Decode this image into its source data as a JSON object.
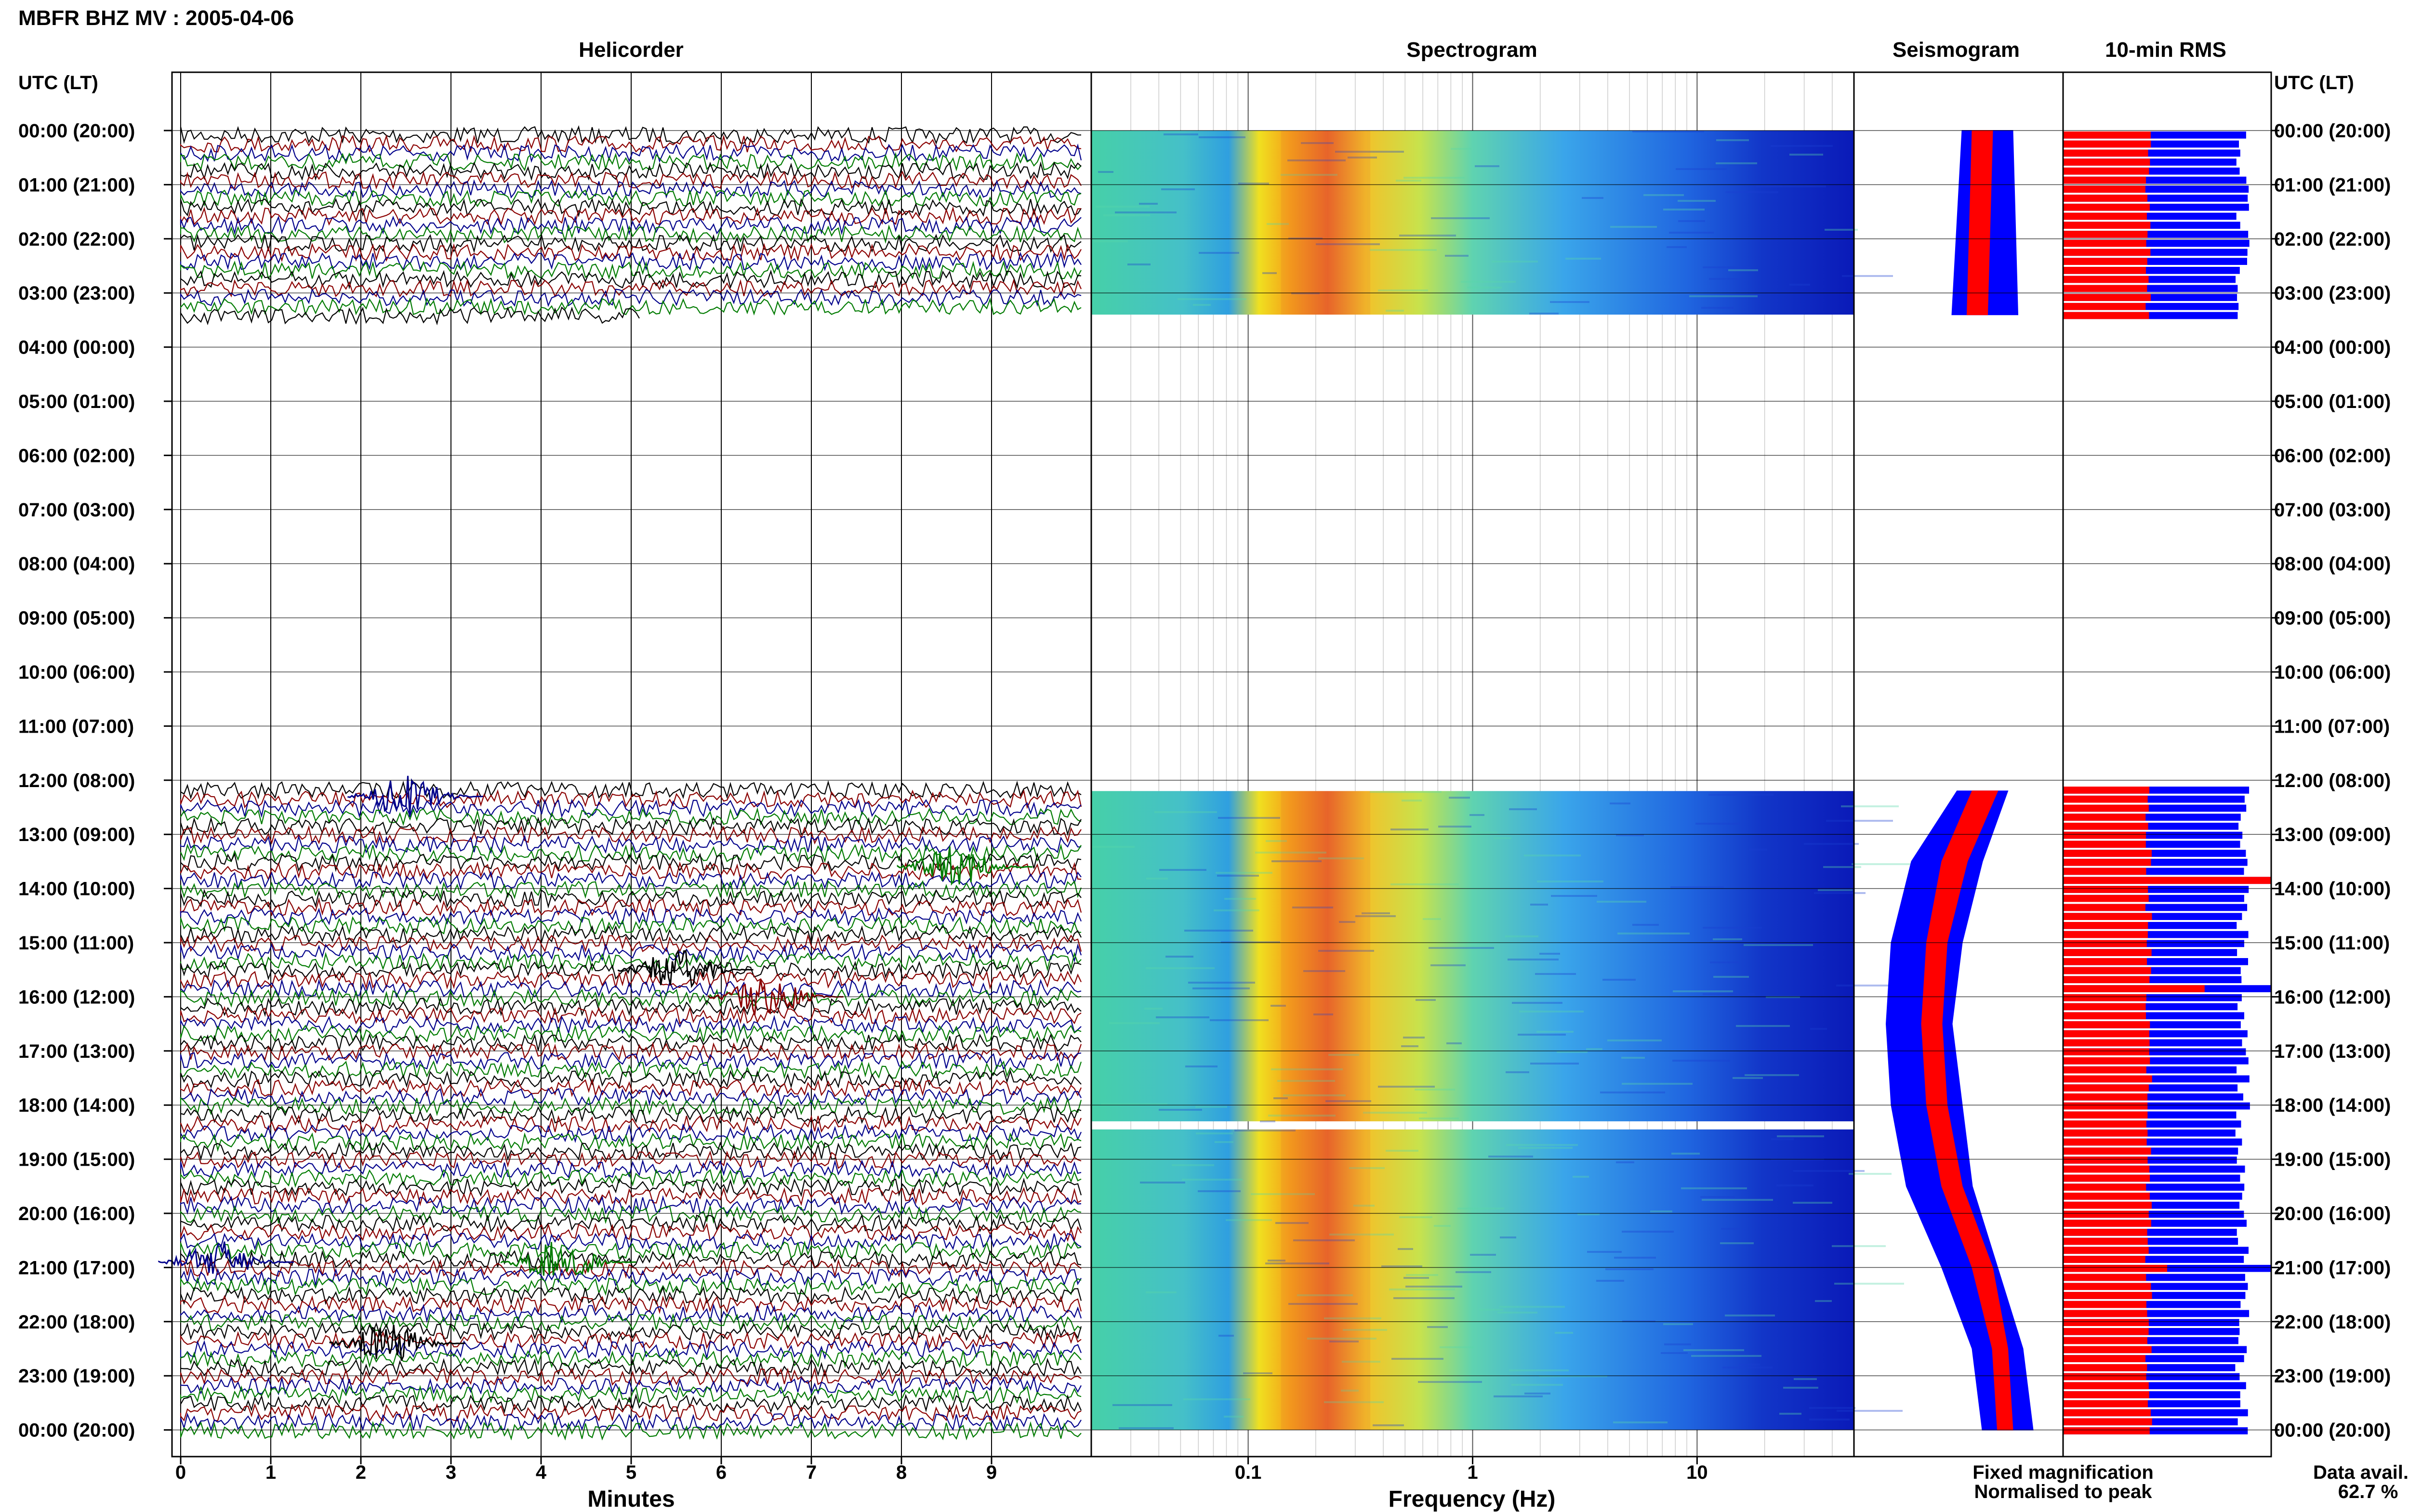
{
  "page_title": "MBFR BHZ MV : 2005-04-06",
  "colors": {
    "trace_cycle": [
      "#000000",
      "#8b0000",
      "#00008b",
      "#007b00"
    ],
    "fixed": "#0000ff",
    "normalised": "#ff0000",
    "grid": "#000000"
  },
  "chart_data": [
    {
      "type": "line",
      "title": "Helicorder",
      "xlabel": "Minutes",
      "ylabel": "UTC (LT)",
      "xlim": [
        0,
        10
      ],
      "x_ticks": [
        "0",
        "1",
        "2",
        "3",
        "4",
        "5",
        "6",
        "7",
        "8",
        "9"
      ],
      "y_tick_labels": [
        "00:00 (20:00)",
        "01:00 (21:00)",
        "02:00 (22:00)",
        "03:00 (23:00)",
        "04:00 (00:00)",
        "05:00 (01:00)",
        "06:00 (02:00)",
        "07:00 (03:00)",
        "08:00 (04:00)",
        "09:00 (05:00)",
        "10:00 (06:00)",
        "11:00 (07:00)",
        "12:00 (08:00)",
        "13:00 (09:00)",
        "14:00 (10:00)",
        "15:00 (11:00)",
        "16:00 (12:00)",
        "17:00 (13:00)",
        "18:00 (14:00)",
        "19:00 (15:00)",
        "20:00 (16:00)",
        "21:00 (17:00)",
        "22:00 (18:00)",
        "23:00 (19:00)",
        "00:00 (20:00)"
      ],
      "ylim_hours": [
        0,
        24
      ],
      "data_segments_hours": [
        [
          0,
          3.5
        ],
        [
          12.1,
          24
        ]
      ],
      "events": [
        {
          "hour": 12.3,
          "minute": 2.5
        },
        {
          "hour": 13.6,
          "minute": 8.6
        },
        {
          "hour": 15.5,
          "minute": 5.5
        },
        {
          "hour": 16.0,
          "minute": 6.5
        },
        {
          "hour": 20.9,
          "minute": 0.4
        },
        {
          "hour": 20.9,
          "minute": 4.2
        },
        {
          "hour": 22.4,
          "minute": 2.3
        }
      ]
    },
    {
      "type": "heatmap",
      "title": "Spectrogram",
      "xlabel": "Frequency (Hz)",
      "xscale": "log",
      "xlim_hz": [
        0.02,
        50
      ],
      "x_ticks": [
        "0.1",
        "1",
        "10"
      ],
      "peak_band_hz": [
        0.14,
        0.35
      ],
      "ylim_hours": [
        0,
        24
      ],
      "data_segments_hours": [
        [
          0,
          3.4
        ],
        [
          12.2,
          18.3
        ],
        [
          18.45,
          24
        ]
      ]
    },
    {
      "type": "area",
      "title": "Seismogram",
      "series": [
        {
          "name": "Fixed magnification",
          "color": "#0000ff",
          "hours": [
            0,
            3.4,
            12.2,
            13.5,
            15,
            16.5,
            18,
            19.5,
            21,
            22.5,
            24
          ],
          "offset_min_max": [
            [
              -0.25,
              0.25
            ],
            [
              -0.35,
              0.3
            ],
            [
              -0.3,
              0.2
            ],
            [
              -0.75,
              -0.05
            ],
            [
              -0.95,
              -0.25
            ],
            [
              -1.0,
              -0.35
            ],
            [
              -0.95,
              -0.25
            ],
            [
              -0.8,
              -0.15
            ],
            [
              -0.45,
              0.1
            ],
            [
              -0.15,
              0.35
            ],
            [
              -0.05,
              0.45
            ]
          ]
        },
        {
          "name": "Normalised to peak",
          "color": "#ff0000",
          "hours": [
            0,
            3.4,
            12.2,
            13.5,
            15,
            16.5,
            18,
            19.5,
            21,
            22.5,
            24
          ],
          "offset_min_max": [
            [
              -0.15,
              0.05
            ],
            [
              -0.2,
              0.0
            ],
            [
              -0.15,
              0.1
            ],
            [
              -0.45,
              -0.2
            ],
            [
              -0.6,
              -0.4
            ],
            [
              -0.65,
              -0.45
            ],
            [
              -0.6,
              -0.4
            ],
            [
              -0.45,
              -0.25
            ],
            [
              -0.15,
              0.05
            ],
            [
              0.05,
              0.2
            ],
            [
              0.1,
              0.25
            ]
          ]
        }
      ]
    },
    {
      "type": "bar",
      "title": "10-min RMS",
      "orientation": "horizontal",
      "series": [
        {
          "name": "Fixed magnification",
          "color": "#0000ff",
          "typical": 0.88,
          "spikes": [
            {
              "hour": 13.8,
              "value": 1.0
            },
            {
              "hour": 15.8,
              "value": 1.0
            },
            {
              "hour": 20.9,
              "value": 1.0
            }
          ]
        },
        {
          "name": "Normalised to peak",
          "color": "#ff0000",
          "typical": 0.42,
          "spikes": [
            {
              "hour": 13.8,
              "value": 1.0
            },
            {
              "hour": 15.8,
              "value": 0.68
            },
            {
              "hour": 20.9,
              "value": 0.5
            }
          ]
        }
      ],
      "data_segments_hours": [
        [
          0,
          3.5
        ],
        [
          12.1,
          24
        ]
      ]
    }
  ],
  "legend": {
    "fixed_label": "Fixed magnification",
    "normalised_label": "Normalised to peak"
  },
  "data_availability": {
    "label": "Data avail.",
    "value": "62.7 %"
  }
}
